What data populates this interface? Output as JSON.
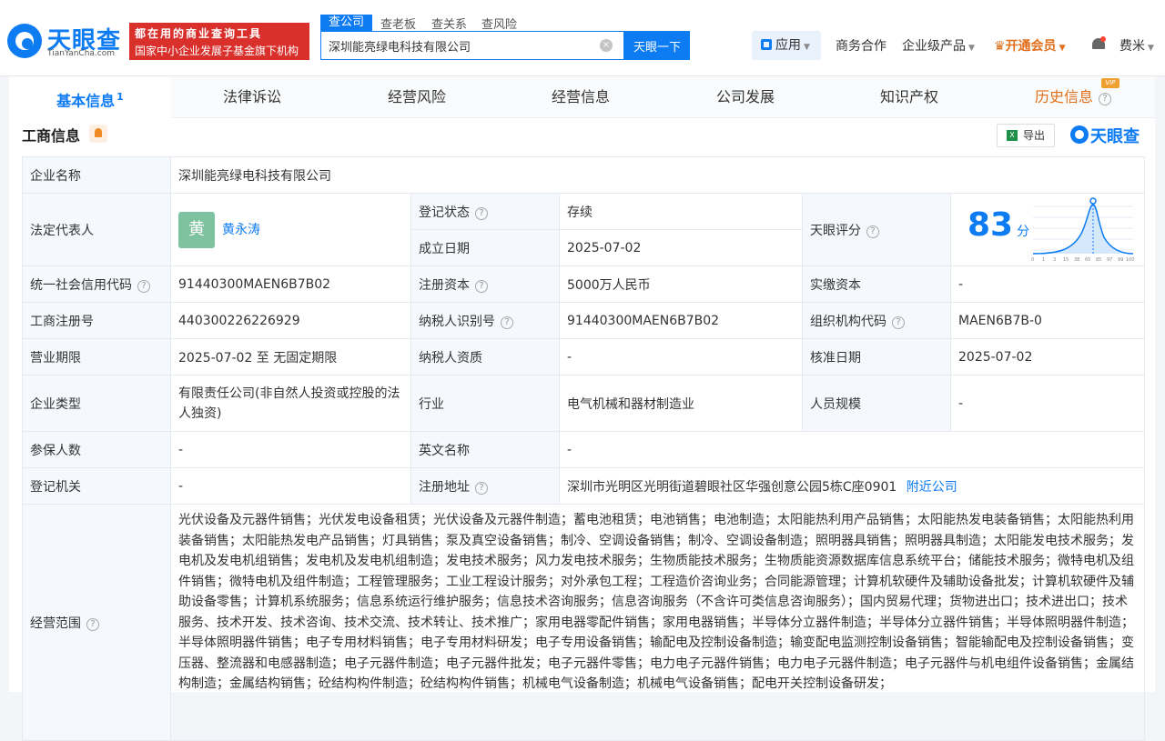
{
  "header": {
    "logo_cn": "天眼查",
    "logo_en": "TianYanCha.com",
    "promo_line1": "都在用的商业查询工具",
    "promo_line2": "国家中小企业发展子基金旗下机构",
    "search_tabs": [
      "查公司",
      "查老板",
      "查关系",
      "查风险"
    ],
    "search_value": "深圳能亮绿电科技有限公司",
    "search_button": "天眼一下",
    "clear_glyph": "×",
    "nav": {
      "app": "应用",
      "business": "商务合作",
      "enterprise": "企业级产品",
      "vip": "开通会员",
      "user": "费米"
    }
  },
  "tabs": [
    {
      "label": "基本信息",
      "count": "1"
    },
    {
      "label": "法律诉讼"
    },
    {
      "label": "经营风险"
    },
    {
      "label": "经营信息"
    },
    {
      "label": "公司发展"
    },
    {
      "label": "知识产权"
    },
    {
      "label": "历史信息"
    }
  ],
  "vip_badge": "VIP",
  "section": {
    "title": "工商信息",
    "export": "导出",
    "brand": "天眼查"
  },
  "info": {
    "company_name_label": "企业名称",
    "company_name": "深圳能亮绿电科技有限公司",
    "legal_rep_label": "法定代表人",
    "legal_rep_avatar": "黄",
    "legal_rep": "黄永涛",
    "reg_status_label": "登记状态",
    "reg_status": "存续",
    "founded_label": "成立日期",
    "founded": "2025-07-02",
    "score_label": "天眼评分",
    "score": "83",
    "score_unit": "分",
    "score_axis": [
      "0",
      "1",
      "3",
      "15",
      "38",
      "65",
      "85",
      "97",
      "99",
      "100"
    ],
    "credit_code_label": "统一社会信用代码",
    "credit_code": "91440300MAEN6B7B02",
    "reg_capital_label": "注册资本",
    "reg_capital": "5000万人民币",
    "paid_capital_label": "实缴资本",
    "paid_capital": "-",
    "reg_no_label": "工商注册号",
    "reg_no": "440300226226929",
    "taxpayer_id_label": "纳税人识别号",
    "taxpayer_id": "91440300MAEN6B7B02",
    "org_code_label": "组织机构代码",
    "org_code": "MAEN6B7B-0",
    "term_label": "营业期限",
    "term": "2025-07-02 至 无固定期限",
    "taxpayer_qual_label": "纳税人资质",
    "taxpayer_qual": "-",
    "approval_label": "核准日期",
    "approval": "2025-07-02",
    "type_label": "企业类型",
    "type": "有限责任公司(非自然人投资或控股的法人独资)",
    "industry_label": "行业",
    "industry": "电气机械和器材制造业",
    "staff_label": "人员规模",
    "staff": "-",
    "insured_label": "参保人数",
    "insured": "-",
    "english_label": "英文名称",
    "english": "-",
    "authority_label": "登记机关",
    "authority": "-",
    "address_label": "注册地址",
    "address": "深圳市光明区光明街道碧眼社区华强创意公园5栋C座0901",
    "nearby": "附近公司",
    "scope_label": "经营范围",
    "scope": "光伏设备及元器件销售；光伏发电设备租赁；光伏设备及元器件制造；蓄电池租赁；电池销售；电池制造；太阳能热利用产品销售；太阳能热发电装备销售；太阳能热利用装备销售；太阳能热发电产品销售；灯具销售；泵及真空设备销售；制冷、空调设备销售；制冷、空调设备制造；照明器具销售；照明器具制造；太阳能发电技术服务；发电机及发电机组销售；发电机及发电机组制造；发电技术服务；风力发电技术服务；生物质能技术服务；生物质能资源数据库信息系统平台；储能技术服务；微特电机及组件销售；微特电机及组件制造；工程管理服务；工业工程设计服务；对外承包工程；工程造价咨询业务；合同能源管理；计算机软硬件及辅助设备批发；计算机软硬件及辅助设备零售；计算机系统服务；信息系统运行维护服务；信息技术咨询服务；信息咨询服务（不含许可类信息咨询服务）；国内贸易代理；货物进出口；技术进出口；技术服务、技术开发、技术咨询、技术交流、技术转让、技术推广；家用电器零配件销售；家用电器销售；半导体分立器件制造；半导体分立器件销售；半导体照明器件制造；半导体照明器件销售；电子专用材料销售；电子专用材料研发；电子专用设备销售；输配电及控制设备制造；输变配电监测控制设备销售；智能输配电及控制设备销售；变压器、整流器和电感器制造；电子元器件制造；电子元器件批发；电子元器件零售；电力电子元器件销售；电力电子元器件制造；电子元器件与机电组件设备销售；金属结构制造；金属结构销售；砼结构构件制造；砼结构构件销售；机械电气设备制造；机械电气设备销售；配电开关控制设备研发；"
  },
  "colors": {
    "brand_blue": "#0d7bf2",
    "promo_red": "#d9302c",
    "status_green": "#1a9a5c",
    "vip_orange": "#e06e1a"
  }
}
